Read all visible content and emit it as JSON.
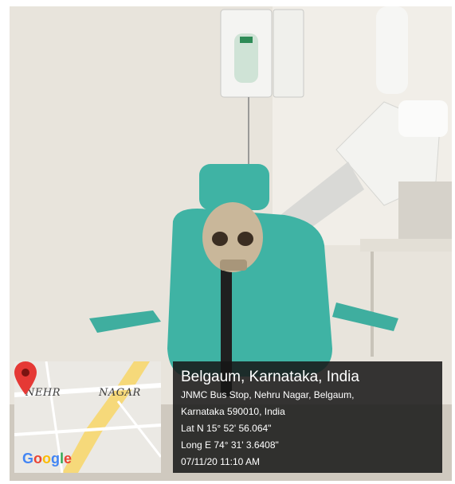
{
  "map": {
    "area_label_left": "NEHR",
    "area_label_right": "NAGAR",
    "brand": [
      "G",
      "o",
      "o",
      "g",
      "l",
      "e"
    ],
    "brand_colors": [
      "#4285F4",
      "#EA4335",
      "#FBBC05",
      "#4285F4",
      "#34A853",
      "#EA4335"
    ],
    "pin_color": "#e53935"
  },
  "geotag": {
    "title": "Belgaum, Karnataka, India",
    "address_line1": "JNMC Bus Stop, Nehru Nagar, Belgaum,",
    "address_line2": "Karnataka 590010, India",
    "latitude": "Lat N 15° 52' 56.064\"",
    "longitude": "Long E 74° 31' 3.6408\"",
    "datetime": "07/11/20 11:10 AM"
  },
  "colors": {
    "chair": "#3fb3a4",
    "overlay": "#161616"
  }
}
